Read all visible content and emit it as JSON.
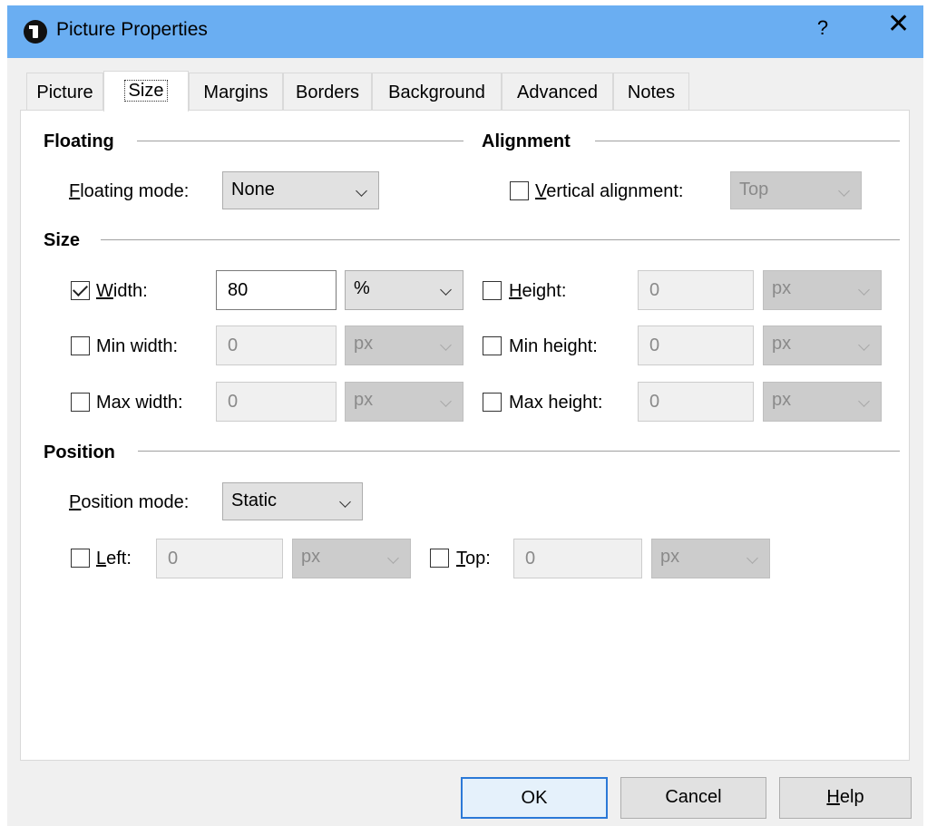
{
  "window": {
    "title": "Picture Properties",
    "help_symbol": "?",
    "close_symbol": "✕",
    "app_icon": "info-circle-icon",
    "title_bar_color": "#6aaef2"
  },
  "tabs": [
    {
      "label": "Picture",
      "active": false
    },
    {
      "label": "Size",
      "active": true
    },
    {
      "label": "Margins",
      "active": false
    },
    {
      "label": "Borders",
      "active": false
    },
    {
      "label": "Background",
      "active": false
    },
    {
      "label": "Advanced",
      "active": false
    },
    {
      "label": "Notes",
      "active": false
    }
  ],
  "floating": {
    "section_title": "Floating",
    "mode_label_ul": "F",
    "mode_label_rest": "loating mode:",
    "mode_value": "None"
  },
  "alignment": {
    "section_title": "Alignment",
    "vertical_label_ul": "V",
    "vertical_label_rest": "ertical alignment:",
    "vertical_checked": false,
    "vertical_value": "Top"
  },
  "size": {
    "section_title": "Size",
    "width": {
      "label_ul": "W",
      "label_rest": "idth:",
      "checked": true,
      "value": "80",
      "unit": "%"
    },
    "height": {
      "label_ul": "H",
      "label_rest": "eight:",
      "checked": false,
      "value": "0",
      "unit": "px"
    },
    "min_width": {
      "label": "Min width:",
      "checked": false,
      "value": "0",
      "unit": "px"
    },
    "min_height": {
      "label": "Min height:",
      "checked": false,
      "value": "0",
      "unit": "px"
    },
    "max_width": {
      "label": "Max width:",
      "checked": false,
      "value": "0",
      "unit": "px"
    },
    "max_height": {
      "label": "Max height:",
      "checked": false,
      "value": "0",
      "unit": "px"
    }
  },
  "position": {
    "section_title": "Position",
    "mode_label_ul": "P",
    "mode_label_rest": "osition mode:",
    "mode_value": "Static",
    "left": {
      "label_ul": "L",
      "label_rest": "eft:",
      "checked": false,
      "value": "0",
      "unit": "px"
    },
    "top": {
      "label_ul": "T",
      "label_rest": "op:",
      "checked": false,
      "value": "0",
      "unit": "px"
    }
  },
  "buttons": {
    "ok": "OK",
    "cancel": "Cancel",
    "help_ul": "H",
    "help_rest": "elp"
  }
}
